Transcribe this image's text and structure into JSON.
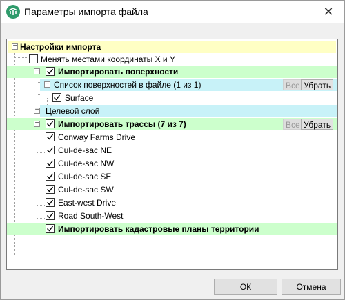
{
  "window": {
    "title": "Параметры импорта файла"
  },
  "tree": {
    "root_label": "Настройки импорта",
    "swap_xy_label": "Менять местами координаты X и Y",
    "import_surfaces_label": "Импортировать поверхности",
    "surface_list_label": "Список поверхностей в файле (1 из 1)",
    "surface_item": "Surface",
    "target_layer_label": "Целевой слой",
    "import_alignments_label": "Импортировать трассы (7 из 7)",
    "alignments": [
      "Conway Farms Drive",
      "Cul-de-sac NE",
      "Cul-de-sac NW",
      "Cul-de-sac SE",
      "Cul-de-sac SW",
      "East-west Drive",
      "Road South-West"
    ],
    "import_cadastral_label": "Импортировать кадастровые планы территории",
    "all_button": "Все",
    "remove_button": "Убрать"
  },
  "buttons": {
    "ok": "ОК",
    "cancel": "Отмена"
  },
  "state": {
    "swap_xy": false,
    "import_surfaces": true,
    "surface_checked": true,
    "import_alignments": true,
    "import_cadastral": true
  },
  "colors": {
    "root_bg": "#ffffc4",
    "group_bg": "#ccffcc",
    "sublist_bg": "#c8f2f8",
    "accent": "#2f9b6b"
  },
  "icons": {
    "app": "app-logo-icon",
    "close": "close-icon",
    "checkbox": "checkmark-icon",
    "expand": "plus-icon",
    "collapse": "minus-icon"
  }
}
